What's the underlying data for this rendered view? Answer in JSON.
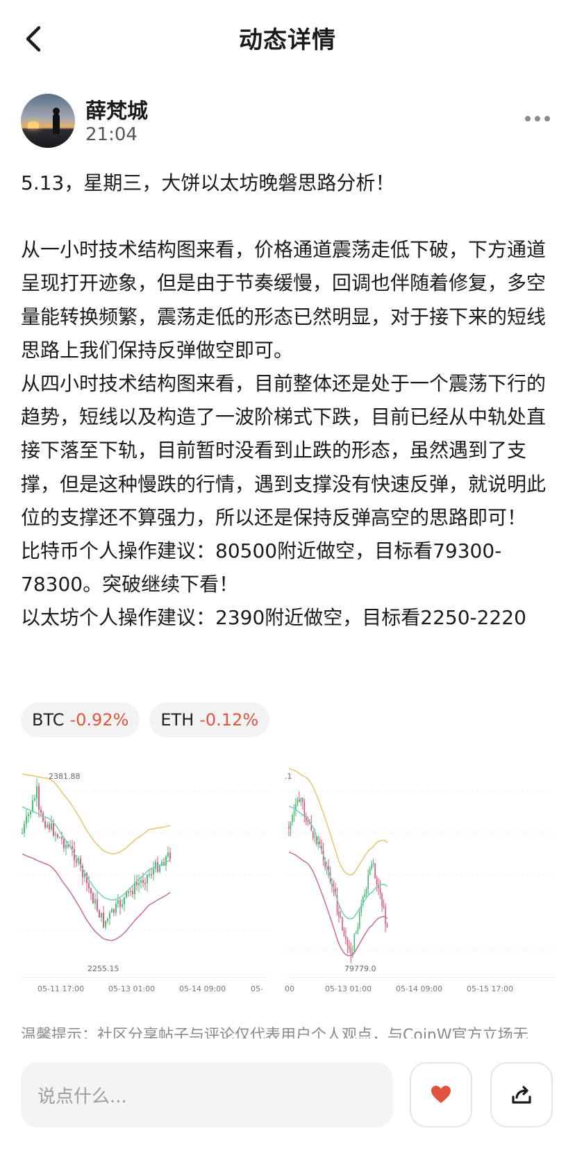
{
  "header": {
    "title": "动态详情"
  },
  "author": {
    "name": "薛梵城",
    "time": "21:04"
  },
  "post": {
    "paragraphs": [
      "5.13，星期三，大饼以太坊晚磐思路分析！",
      "",
      "从一小时技术结构图来看，价格通道震荡走低下破，下方通道呈现打开迹象，但是由于节奏缓慢，回调也伴随着修复，多空量能转换频繁，震荡走低的形态已然明显，对于接下来的短线思路上我们保持反弹做空即可。",
      "从四小时技术结构图来看，目前整体还是处于一个震荡下行的趋势，短线以及构造了一波阶梯式下跌，目前已经从中轨处直接下落至下轨，目前暂时没看到止跌的形态，虽然遇到了支撑，但是这种慢跌的行情，遇到支撑没有快速反弹，就说明此位的支撑还不算强力，所以还是保持反弹高空的思路即可！",
      "比特币个人操作建议：80500附近做空，目标看79300-78300。突破继续下看！",
      "以太坊个人操作建议：2390附近做空，目标看2250-2220"
    ]
  },
  "tags": [
    {
      "symbol": "BTC",
      "change": "-0.92%"
    },
    {
      "symbol": "ETH",
      "change": "-0.12%"
    }
  ],
  "charts": [
    {
      "high_label": "2381.88",
      "low_label": "2255.15",
      "x_ticks": [
        "05-11 17:00",
        "05-13 01:00",
        "05-14 09:00",
        "05-"
      ]
    },
    {
      "high_label": ".1",
      "low_label": "79779.0",
      "x_ticks": [
        "00",
        "05-13 01:00",
        "05-14 09:00",
        "05-15 17:00"
      ]
    }
  ],
  "notice": "温馨提示：社区分享帖子与评论仅代表用户个人观点，与CoinW官方立场无",
  "bottom": {
    "input_placeholder": "说点什么..."
  },
  "colors": {
    "negative": "#e0533d",
    "like": "#e0533d",
    "upper_band": "#e8c46a",
    "mid_band": "#6fcfb8",
    "lower_band": "#c96a9a"
  }
}
